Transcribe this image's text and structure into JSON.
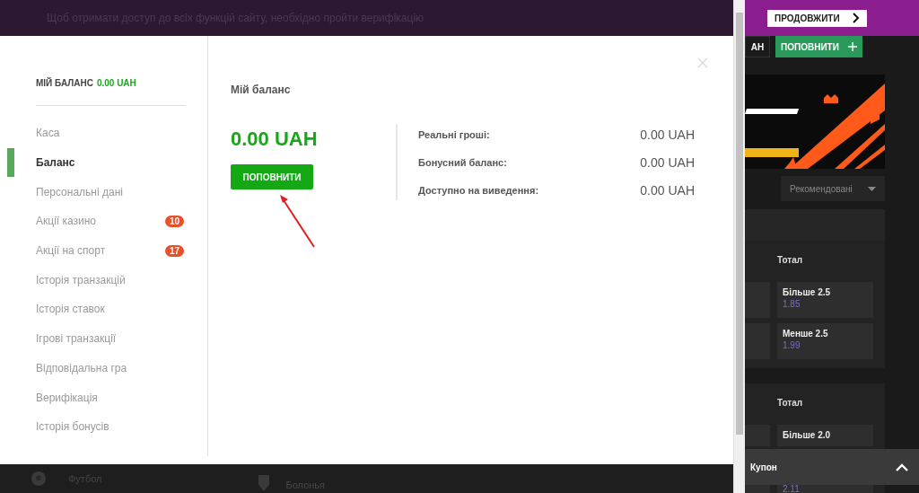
{
  "notice_bar": {
    "text": "Щоб отримати доступ до всіх функцій сайту, необхідно пройти верифікацію",
    "continue_button": "ПРОДОВЖИТИ"
  },
  "header": {
    "partial_button": "АН",
    "deposit_button": "ПОПОВНИТИ"
  },
  "modal": {
    "balance_label": "МІЙ БАЛАНС",
    "balance_value": "0.00 UAH",
    "menu": [
      {
        "label": "Каса",
        "selected": false
      },
      {
        "label": "Баланс",
        "selected": true
      },
      {
        "label": "Персональні дані",
        "selected": false
      },
      {
        "label": "Акції казино",
        "selected": false,
        "badge": "10"
      },
      {
        "label": "Акції на спорт",
        "selected": false,
        "badge": "17"
      },
      {
        "label": "Історія транзакцій",
        "selected": false
      },
      {
        "label": "Історія ставок",
        "selected": false
      },
      {
        "label": "Ігрові транзакції",
        "selected": false
      },
      {
        "label": "Відповідальна гра",
        "selected": false
      },
      {
        "label": "Верифікація",
        "selected": false
      },
      {
        "label": "Історія бонусів",
        "selected": false
      }
    ],
    "title": "Мій баланс",
    "amount": "0.00 UAH",
    "deposit_button": "ПОПОВНИТИ",
    "details": [
      {
        "label": "Реальні гроші:",
        "value": "0.00 UAH"
      },
      {
        "label": "Бонусний баланс:",
        "value": "0.00 UAH"
      },
      {
        "label": "Доступно на виведення:",
        "value": "0.00 UAH"
      }
    ]
  },
  "sort_dropdown": "Рекомендовані",
  "markets": [
    {
      "title": "Тотал",
      "odds": [
        {
          "label": "Більше 2.5",
          "value": "1.85"
        },
        {
          "label": "Менше 2.5",
          "value": "1.99"
        }
      ]
    },
    {
      "title": "Тотал",
      "odds": [
        {
          "label": "Більше 2.0"
        },
        {
          "value": "2.11"
        }
      ]
    }
  ],
  "coupon": "Купон",
  "footer_row": {
    "sport": "Футбол",
    "team": "Болонья"
  }
}
